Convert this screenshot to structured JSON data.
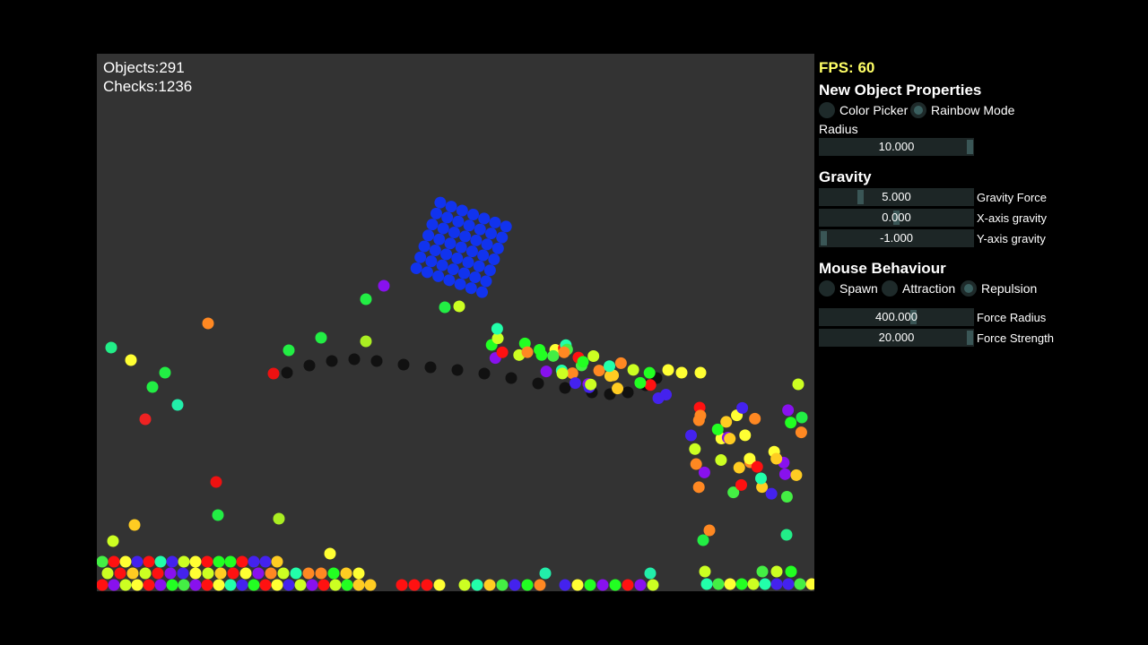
{
  "stats": {
    "objects": "Objects:291",
    "checks": "Checks:1236"
  },
  "panel": {
    "fps": "FPS: 60",
    "new_object_header": "New Object Properties",
    "color_picker": "Color Picker",
    "rainbow_mode": "Rainbow Mode",
    "radius_label": "Radius",
    "radius_value": "10.000",
    "gravity_header": "Gravity",
    "gravity_force_value": "5.000",
    "gravity_force_label": "Gravity Force",
    "x_gravity_value": "0.000",
    "x_gravity_label": "X-axis gravity",
    "y_gravity_value": "-1.000",
    "y_gravity_label": "Y-axis gravity",
    "mouse_header": "Mouse Behaviour",
    "spawn": "Spawn",
    "attraction": "Attraction",
    "repulsion": "Repulsion",
    "force_radius_value": "400.000",
    "force_radius_label": "Force Radius",
    "force_strength_value": "20.000",
    "force_strength_label": "Force Strength"
  },
  "colors": {
    "canvas_bg": "#333333",
    "fps": "#ffff66",
    "box": "#1133ee",
    "rope": "#111111"
  }
}
